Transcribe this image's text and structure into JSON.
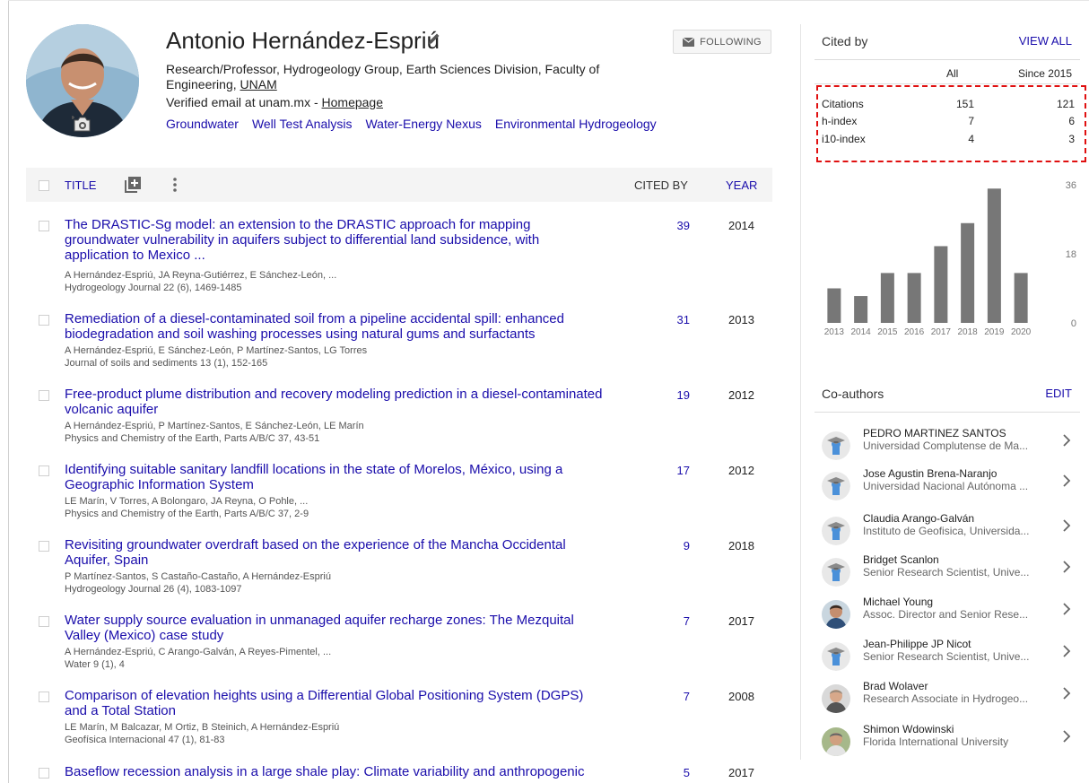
{
  "profile": {
    "name": "Antonio Hernández-Espriú",
    "affiliation_prefix": "Research/Professor, Hydrogeology Group, Earth Sciences Division, Faculty of Engineering, ",
    "affiliation_link": "UNAM",
    "email_text": "Verified email at unam.mx - ",
    "homepage_label": "Homepage",
    "follow_label": "FOLLOWING",
    "interests": [
      "Groundwater",
      "Well Test Analysis",
      "Water-Energy Nexus",
      "Environmental Hydrogeology"
    ]
  },
  "table_header": {
    "title": "TITLE",
    "cited_by": "CITED BY",
    "year": "YEAR"
  },
  "articles": [
    {
      "title": "The DRASTIC-Sg model: an extension to the DRASTIC approach for mapping groundwater vulnerability in aquifers subject to differential land subsidence, with application to Mexico ...",
      "authors": "A Hernández-Espriú, JA Reyna-Gutiérrez, E Sánchez-León, ...",
      "venue": "Hydrogeology Journal 22 (6), 1469-1485",
      "cited": "39",
      "year": "2014"
    },
    {
      "title": "Remediation of a diesel-contaminated soil from a pipeline accidental spill: enhanced biodegradation and soil washing processes using natural gums and surfactants",
      "authors": "A Hernández-Espriú, E Sánchez-León, P Martínez-Santos, LG Torres",
      "venue": "Journal of soils and sediments 13 (1), 152-165",
      "cited": "31",
      "year": "2013"
    },
    {
      "title": "Free-product plume distribution and recovery modeling prediction in a diesel-contaminated volcanic aquifer",
      "authors": "A Hernández-Espriú, P Martínez-Santos, E Sánchez-León, LE Marín",
      "venue": "Physics and Chemistry of the Earth, Parts A/B/C 37, 43-51",
      "cited": "19",
      "year": "2012"
    },
    {
      "title": "Identifying suitable sanitary landfill locations in the state of Morelos, México, using a Geographic Information System",
      "authors": "LE Marín, V Torres, A Bolongaro, JA Reyna, O Pohle, ...",
      "venue": "Physics and Chemistry of the Earth, Parts A/B/C 37, 2-9",
      "cited": "17",
      "year": "2012"
    },
    {
      "title": "Revisiting groundwater overdraft based on the experience of the Mancha Occidental Aquifer, Spain",
      "authors": "P Martínez-Santos, S Castaño-Castaño, A Hernández-Espriú",
      "venue": "Hydrogeology Journal 26 (4), 1083-1097",
      "cited": "9",
      "year": "2018"
    },
    {
      "title": "Water supply source evaluation in unmanaged aquifer recharge zones: The Mezquital Valley (Mexico) case study",
      "authors": "A Hernández-Espriú, C Arango-Galván, A Reyes-Pimentel, ...",
      "venue": "Water 9 (1), 4",
      "cited": "7",
      "year": "2017"
    },
    {
      "title": "Comparison of elevation heights using a Differential Global Positioning System (DGPS) and a Total Station",
      "authors": "LE Marín, M Balcazar, M Ortiz, B Steinich, A Hernández-Espriú",
      "venue": "Geofísica Internacional 47 (1), 81-83",
      "cited": "7",
      "year": "2008"
    },
    {
      "title": "Baseflow recession analysis in a large shale play: Climate variability and anthropogenic",
      "authors": "",
      "venue": "",
      "cited": "5",
      "year": "2017"
    }
  ],
  "cited_by": {
    "title": "Cited by",
    "view_all": "VIEW ALL",
    "col_all": "All",
    "col_since": "Since 2015",
    "stats": [
      {
        "label": "Citations",
        "all": "151",
        "since": "121"
      },
      {
        "label": "h-index",
        "all": "7",
        "since": "6"
      },
      {
        "label": "i10-index",
        "all": "4",
        "since": "3"
      }
    ]
  },
  "chart_data": {
    "type": "bar",
    "categories": [
      "2013",
      "2014",
      "2015",
      "2016",
      "2017",
      "2018",
      "2019",
      "2020"
    ],
    "values": [
      9,
      7,
      13,
      13,
      20,
      26,
      35,
      13
    ],
    "ylim": [
      0,
      36
    ],
    "yticks": [
      "36",
      "18",
      "0"
    ],
    "bar_color": "#777777"
  },
  "coauthors_section": {
    "title": "Co-authors",
    "edit": "EDIT"
  },
  "coauthors": [
    {
      "name": "PEDRO MARTINEZ SANTOS",
      "affil": "Universidad Complutense de Ma...",
      "avatar": "default"
    },
    {
      "name": "Jose Agustin Brena-Naranjo",
      "affil": "Universidad Nacional Autónoma ...",
      "avatar": "default"
    },
    {
      "name": "Claudia Arango-Galván",
      "affil": "Instituto de Geofisica, Universida...",
      "avatar": "default"
    },
    {
      "name": "Bridget Scanlon",
      "affil": "Senior Research Scientist, Unive...",
      "avatar": "default"
    },
    {
      "name": "Michael Young",
      "affil": "Assoc. Director and Senior Rese...",
      "avatar": "photo-blue"
    },
    {
      "name": "Jean-Philippe JP Nicot",
      "affil": "Senior Research Scientist, Unive...",
      "avatar": "default"
    },
    {
      "name": "Brad Wolaver",
      "affil": "Research Associate in Hydrogeo...",
      "avatar": "photo-gray"
    },
    {
      "name": "Shimon Wdowinski",
      "affil": "Florida International University",
      "avatar": "photo-green"
    }
  ]
}
